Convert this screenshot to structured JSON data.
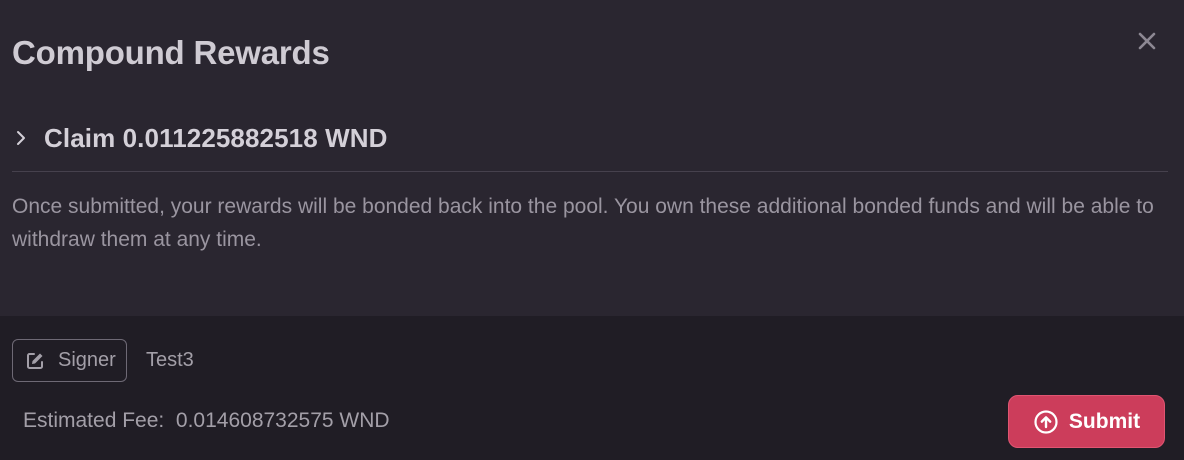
{
  "modal": {
    "title": "Compound Rewards",
    "close_icon": "close-icon"
  },
  "claim": {
    "label": "Claim 0.011225882518 WND",
    "icon": "chevron-right-icon",
    "expanded": false
  },
  "description": "Once submitted, your rewards will be bonded back into the pool. You own these additional bonded funds and will be able to withdraw them at any time.",
  "footer": {
    "signer_button_label": "Signer",
    "signer_icon": "edit-icon",
    "signer_name": "Test3",
    "estimated_fee_label": "Estimated Fee:",
    "estimated_fee_value": "0.014608732575 WND",
    "submit_label": "Submit",
    "submit_icon": "arrow-up-circle-icon"
  },
  "colors": {
    "background": "#2a2630",
    "footer_background": "#201d25",
    "accent": "#cc3d5b",
    "text_primary": "#d4d0d8",
    "text_secondary": "#9a95a0"
  }
}
